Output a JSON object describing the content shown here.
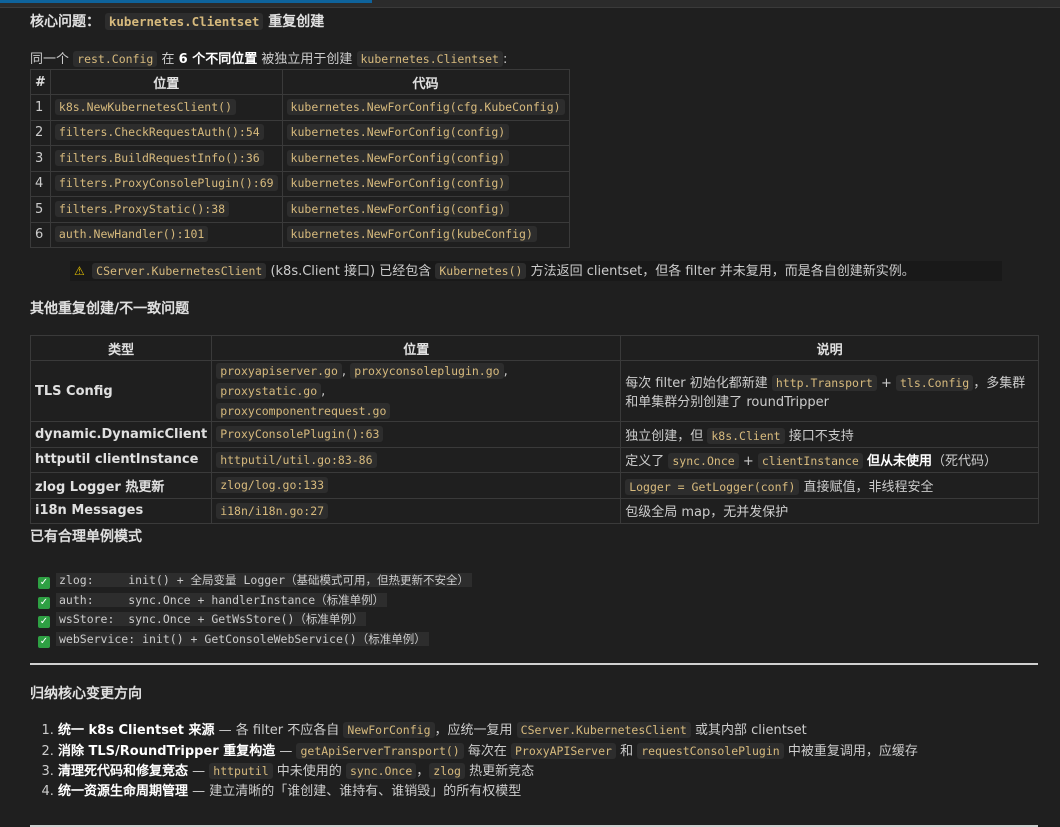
{
  "core": {
    "heading_prefix": "核心问题：",
    "heading_code": "kubernetes.Clientset",
    "heading_suffix": "重复创建",
    "para_pre": "同一个",
    "para_code1": "rest.Config",
    "para_mid1": "在",
    "para_bold": "6 个不同位置",
    "para_mid2": "被独立用于创建",
    "para_code2": "kubernetes.Clientset",
    "para_end": ":"
  },
  "locations_table": {
    "headers": [
      "#",
      "位置",
      "代码"
    ],
    "rows": [
      {
        "n": "1",
        "loc": "k8s.NewKubernetesClient()",
        "code": "kubernetes.NewForConfig(cfg.KubeConfig)"
      },
      {
        "n": "2",
        "loc": "filters.CheckRequestAuth():54",
        "code": "kubernetes.NewForConfig(config)"
      },
      {
        "n": "3",
        "loc": "filters.BuildRequestInfo():36",
        "code": "kubernetes.NewForConfig(config)"
      },
      {
        "n": "4",
        "loc": "filters.ProxyConsolePlugin():69",
        "code": "kubernetes.NewForConfig(config)"
      },
      {
        "n": "5",
        "loc": "filters.ProxyStatic():38",
        "code": "kubernetes.NewForConfig(config)"
      },
      {
        "n": "6",
        "loc": "auth.NewHandler():101",
        "code": "kubernetes.NewForConfig(kubeConfig)"
      }
    ]
  },
  "warning": {
    "icon": "warning-icon",
    "code1": "CServer.KubernetesClient",
    "text1": "(k8s.Client 接口) 已经包含",
    "code2": "Kubernetes()",
    "text2": "方法返回 clientset，但各 filter 并未复用，而是各自创建新实例。"
  },
  "other": {
    "heading": "其他重复创建/不一致问题",
    "headers": [
      "类型",
      "位置",
      "说明"
    ],
    "tls": {
      "type": "TLS Config",
      "loc1": "proxyapiserver.go",
      "loc2": "proxyconsoleplugin.go",
      "loc3": "proxystatic.go",
      "loc4": "proxycomponentrequest.go",
      "comma": ",",
      "desc_pre": "每次 filter 初始化都新建",
      "desc_code1": "http.Transport",
      "desc_plus": "+",
      "desc_code2": "tls.Config",
      "desc_post": "，多集群和单集群分别创建了 roundTripper"
    },
    "dynamic": {
      "type": "dynamic.DynamicClient",
      "loc": "ProxyConsolePlugin():63",
      "desc_pre": "独立创建，但",
      "desc_code": "k8s.Client",
      "desc_post": "接口不支持"
    },
    "httputil": {
      "type": "httputil clientInstance",
      "loc": "httputil/util.go:83-86",
      "desc_pre": "定义了",
      "desc_code1": "sync.Once",
      "desc_plus": "+",
      "desc_code2": "clientInstance",
      "desc_bold": "但从未使用",
      "desc_post": "（死代码）"
    },
    "zlog": {
      "type": "zlog Logger 热更新",
      "loc": "zlog/log.go:133",
      "desc_code": "Logger = GetLogger(conf)",
      "desc_post": "直接赋值，非线程安全"
    },
    "i18n": {
      "type": "i18n Messages",
      "loc": "i18n/i18n.go:27",
      "desc": "包级全局 map，无并发保护"
    }
  },
  "singletons": {
    "heading": "已有合理单例模式",
    "check_glyph": "✓",
    "lines": [
      "zlog:     init() + 全局变量 Logger（基础模式可用，但热更新不安全）",
      "auth:     sync.Once + handlerInstance（标准单例）",
      "wsStore:  sync.Once + GetWsStore()（标准单例）",
      "webService: init() + GetConsoleWebService()（标准单例）"
    ]
  },
  "summary": {
    "heading": "归纳核心变更方向",
    "items": [
      {
        "bold": "统一 k8s Clientset 来源",
        "t1": " — 各 filter 不应各自 ",
        "c1": "NewForConfig",
        "t2": "，应统一复用 ",
        "c2": "CServer.KubernetesClient",
        "t3": " 或其内部 clientset"
      },
      {
        "bold": "消除 TLS/RoundTripper 重复构造",
        "t1": " — ",
        "c1": "getApiServerTransport()",
        "t2": " 每次在 ",
        "c2": "ProxyAPIServer",
        "t3": " 和 ",
        "c3": "requestConsolePlugin",
        "t4": " 中被重复调用，应缓存"
      },
      {
        "bold": "清理死代码和修复竞态",
        "t1": " — ",
        "c1": "httputil",
        "t2": " 中未使用的 ",
        "c2": "sync.Once",
        "t3": "，",
        "c3": "zlog",
        "t4": " 热更新竞态"
      },
      {
        "bold": "统一资源生命周期管理",
        "t1": " — 建立清晰的「谁创建、谁持有、谁销毁」的所有权模型"
      }
    ]
  }
}
